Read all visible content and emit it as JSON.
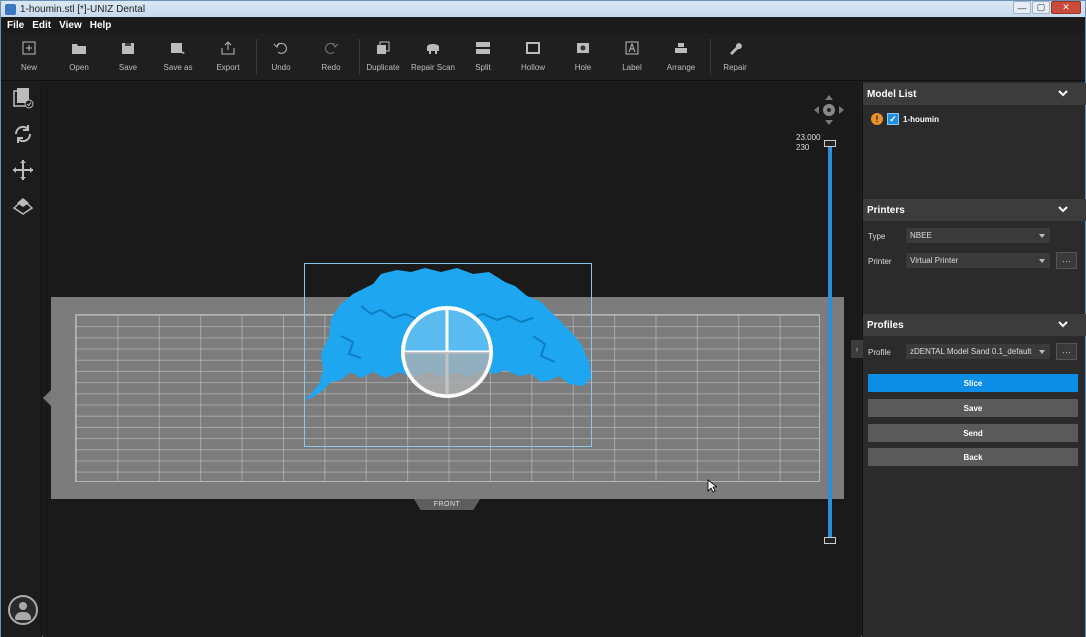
{
  "window": {
    "title": "1-houmin.stl [*]-UNIZ Dental",
    "controls": {
      "minimize": "—",
      "maximize": "▢",
      "close": "✕"
    }
  },
  "menu": [
    "File",
    "Edit",
    "View",
    "Help"
  ],
  "toolbar": [
    {
      "label": "New",
      "icon": "new-icon"
    },
    {
      "label": "Open",
      "icon": "open-folder-icon"
    },
    {
      "label": "Save",
      "icon": "save-icon"
    },
    {
      "label": "Save as",
      "icon": "save-as-icon"
    },
    {
      "label": "Export",
      "icon": "export-icon"
    },
    {
      "label": "Undo",
      "icon": "undo-icon"
    },
    {
      "label": "Redo",
      "icon": "redo-icon"
    },
    {
      "label": "Duplicate",
      "icon": "duplicate-icon"
    },
    {
      "label": "Repair Scan",
      "icon": "repair-scan-icon"
    },
    {
      "label": "Split",
      "icon": "split-icon"
    },
    {
      "label": "Hollow",
      "icon": "hollow-icon"
    },
    {
      "label": "Hole",
      "icon": "hole-icon"
    },
    {
      "label": "Label",
      "icon": "label-icon"
    },
    {
      "label": "Arrange",
      "icon": "arrange-icon"
    },
    {
      "label": "Repair",
      "icon": "wrench-icon"
    }
  ],
  "viewport": {
    "front_label": "FRONT",
    "slider_value_top": "23.000",
    "slider_value_bottom": "230",
    "model_color": "#1ea7f0",
    "platform_color": "#7c7c7c"
  },
  "panel": {
    "model_list": {
      "title": "Model List",
      "items": [
        {
          "name": "1-houmin",
          "checked": true,
          "warning": "!"
        }
      ]
    },
    "printers": {
      "title": "Printers",
      "type_label": "Type",
      "type_value": "NBEE",
      "printer_label": "Printer",
      "printer_value": "Virtual Printer",
      "more": "···"
    },
    "profiles": {
      "title": "Profiles",
      "profile_label": "Profile",
      "profile_value": "zDENTAL Model Sand 0.1_default",
      "more": "···"
    },
    "actions": {
      "slice": "Slice",
      "save": "Save",
      "send": "Send",
      "back": "Back"
    },
    "accent": "#0d8ee6"
  }
}
